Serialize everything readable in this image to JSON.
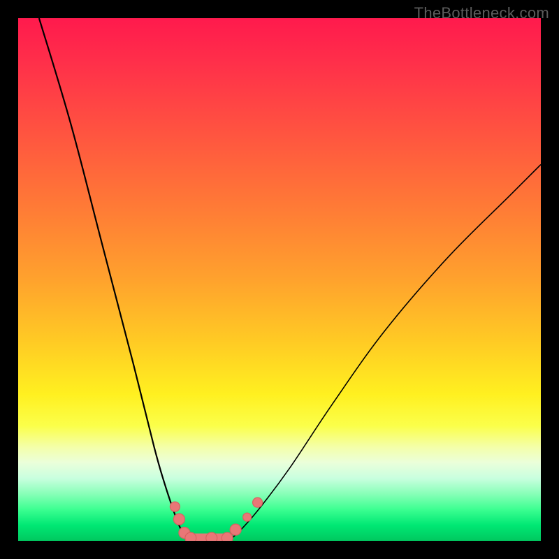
{
  "watermark": "TheBottleneck.com",
  "colors": {
    "marker": "#e97777",
    "curve": "#000000"
  },
  "chart_data": {
    "type": "line",
    "title": "",
    "xlabel": "",
    "ylabel": "",
    "xlim": [
      0,
      100
    ],
    "ylim": [
      0,
      100
    ],
    "series": [
      {
        "name": "left-curve",
        "x": [
          4,
          10,
          16,
          22,
          26,
          28,
          30,
          31,
          32,
          33
        ],
        "y": [
          100,
          80,
          57,
          34,
          18,
          11,
          5,
          2.5,
          0.8,
          0
        ]
      },
      {
        "name": "right-curve",
        "x": [
          40,
          42,
          46,
          52,
          60,
          70,
          82,
          94,
          100
        ],
        "y": [
          0,
          1.5,
          6,
          14,
          26,
          40,
          54,
          66,
          72
        ]
      }
    ],
    "flat_segment": {
      "x0": 33,
      "x1": 40,
      "y": 0
    },
    "markers": [
      {
        "x": 30.0,
        "y": 6.0,
        "r": 7
      },
      {
        "x": 30.8,
        "y": 3.6,
        "r": 8
      },
      {
        "x": 31.8,
        "y": 1.0,
        "r": 8
      },
      {
        "x": 33.0,
        "y": 0.0,
        "r": 8
      },
      {
        "x": 37.0,
        "y": 0.0,
        "r": 8
      },
      {
        "x": 40.0,
        "y": 0.0,
        "r": 8
      },
      {
        "x": 41.6,
        "y": 1.6,
        "r": 8
      },
      {
        "x": 43.8,
        "y": 4.0,
        "r": 6
      },
      {
        "x": 45.8,
        "y": 6.8,
        "r": 7
      }
    ]
  }
}
